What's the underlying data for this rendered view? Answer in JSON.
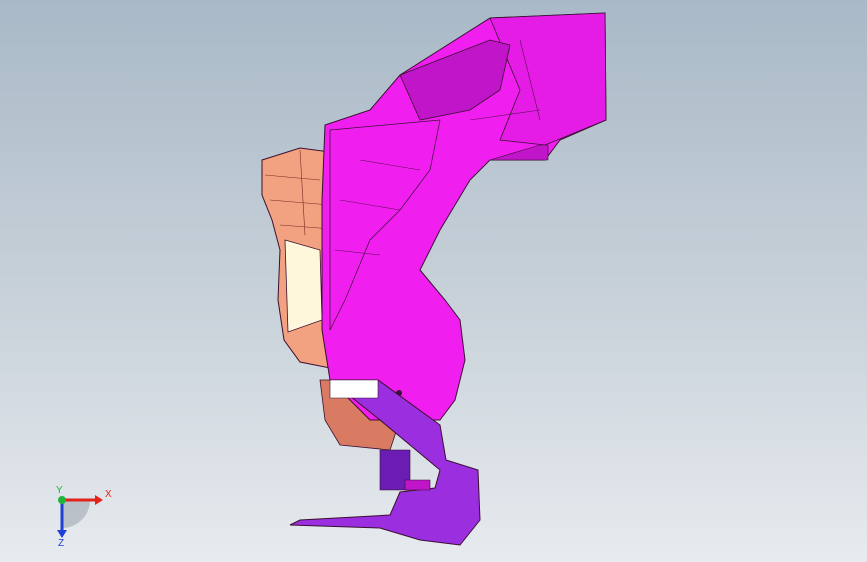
{
  "viewport": {
    "background_top": "#a9b9c7",
    "background_bottom": "#e7ebef"
  },
  "model": {
    "colors": {
      "magenta": "#f01ff0",
      "magenta_dark": "#c015c8",
      "purple": "#9b2fe0",
      "purple_dark": "#6a1cb3",
      "salmon": "#f2a181",
      "salmon_dark": "#d97b63",
      "cream": "#fff7dc",
      "edge": "#3a1030"
    }
  },
  "triad": {
    "x_label": "X",
    "y_label": "Y",
    "z_label": "Z",
    "x_color": "#e2231a",
    "y_color": "#22b33a",
    "z_color": "#1f3fd6"
  }
}
